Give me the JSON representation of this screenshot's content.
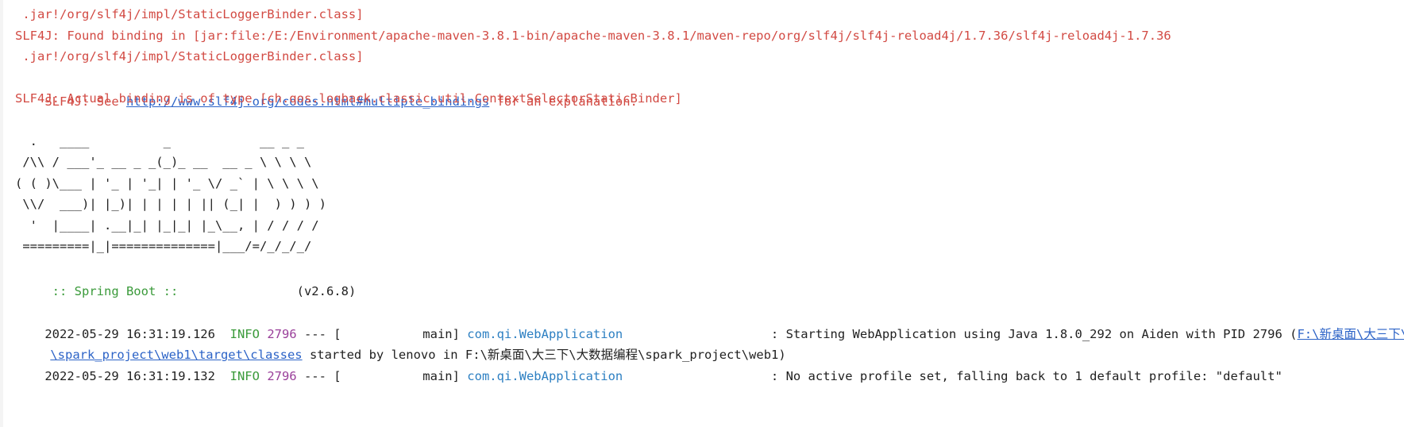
{
  "slf4j": {
    "line1": " .jar!/org/slf4j/impl/StaticLoggerBinder.class]",
    "line2": "SLF4J: Found binding in [jar:file:/E:/Environment/apache-maven-3.8.1-bin/apache-maven-3.8.1/maven-repo/org/slf4j/slf4j-reload4j/1.7.36/slf4j-reload4j-1.7.36",
    "line3": " .jar!/org/slf4j/impl/StaticLoggerBinder.class]",
    "see_prefix": "SLF4J: See ",
    "see_link": "http://www.slf4j.org/codes.html#multiple_bindings",
    "see_suffix": " for an explanation.",
    "actual_binding": "SLF4J: Actual binding is of type [ch.qos.logback.classic.util.ContextSelectorStaticBinder]"
  },
  "banner": [
    "  .   ____          _            __ _ _",
    " /\\\\ / ___'_ __ _ _(_)_ __  __ _ \\ \\ \\ \\",
    "( ( )\\___ | '_ | '_| | '_ \\/ _` | \\ \\ \\ \\",
    " \\\\/  ___)| |_)| | | | | || (_| |  ) ) ) )",
    "  '  |____| .__|_| |_|_| |_\\__, | / / / /",
    " =========|_|==============|___/=/_/_/_/"
  ],
  "spring_boot": {
    "label": " :: Spring Boot ::",
    "version": "                (v2.6.8)"
  },
  "logs": [
    {
      "timestamp": "2022-05-29 16:31:19.126",
      "level": "INFO",
      "pid": "2796",
      "separator": " --- [",
      "thread": "           main]",
      "logger": "com.qi.WebApplication",
      "message_prefix": "                    : Starting WebApplication using Java 1.8.0_292 on Aiden with PID 2796 (",
      "path_link_part1": "F:\\新桌面\\大三下\\大数据编程",
      "path_link_part2": "\\spark_project\\web1\\target\\classes",
      "message_suffix": " started by lenovo in F:\\新桌面\\大三下\\大数据编程\\spark_project\\web1)"
    },
    {
      "timestamp": "2022-05-29 16:31:19.132",
      "level": "INFO",
      "pid": "2796",
      "separator": " --- [",
      "thread": "           main]",
      "logger": "com.qi.WebApplication",
      "message": "                    : No active profile set, falling back to 1 default profile: \"default\""
    }
  ],
  "colors": {
    "error": "#d24a43",
    "link": "#2c63c7",
    "info": "#3a9a3a",
    "pid": "#9a3f9a",
    "logger": "#2c7fc2"
  }
}
